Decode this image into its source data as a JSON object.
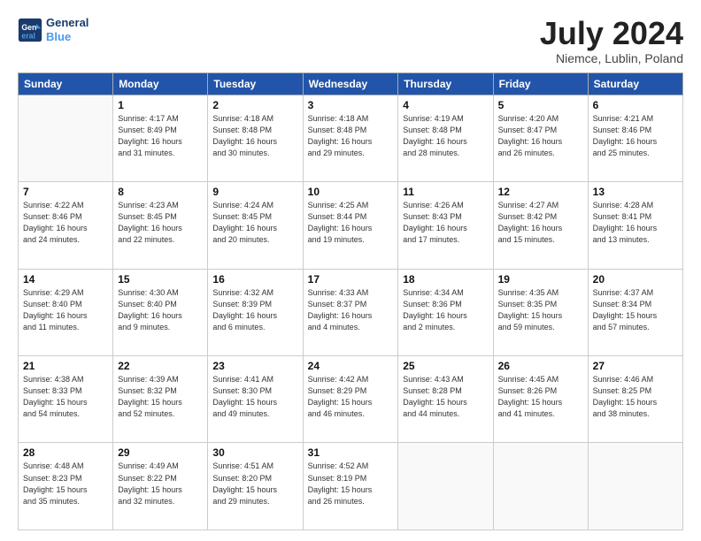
{
  "logo": {
    "line1": "General",
    "line2": "Blue"
  },
  "title": "July 2024",
  "subtitle": "Niemce, Lublin, Poland",
  "headers": [
    "Sunday",
    "Monday",
    "Tuesday",
    "Wednesday",
    "Thursday",
    "Friday",
    "Saturday"
  ],
  "weeks": [
    [
      {
        "day": "",
        "info": ""
      },
      {
        "day": "1",
        "info": "Sunrise: 4:17 AM\nSunset: 8:49 PM\nDaylight: 16 hours\nand 31 minutes."
      },
      {
        "day": "2",
        "info": "Sunrise: 4:18 AM\nSunset: 8:48 PM\nDaylight: 16 hours\nand 30 minutes."
      },
      {
        "day": "3",
        "info": "Sunrise: 4:18 AM\nSunset: 8:48 PM\nDaylight: 16 hours\nand 29 minutes."
      },
      {
        "day": "4",
        "info": "Sunrise: 4:19 AM\nSunset: 8:48 PM\nDaylight: 16 hours\nand 28 minutes."
      },
      {
        "day": "5",
        "info": "Sunrise: 4:20 AM\nSunset: 8:47 PM\nDaylight: 16 hours\nand 26 minutes."
      },
      {
        "day": "6",
        "info": "Sunrise: 4:21 AM\nSunset: 8:46 PM\nDaylight: 16 hours\nand 25 minutes."
      }
    ],
    [
      {
        "day": "7",
        "info": "Sunrise: 4:22 AM\nSunset: 8:46 PM\nDaylight: 16 hours\nand 24 minutes."
      },
      {
        "day": "8",
        "info": "Sunrise: 4:23 AM\nSunset: 8:45 PM\nDaylight: 16 hours\nand 22 minutes."
      },
      {
        "day": "9",
        "info": "Sunrise: 4:24 AM\nSunset: 8:45 PM\nDaylight: 16 hours\nand 20 minutes."
      },
      {
        "day": "10",
        "info": "Sunrise: 4:25 AM\nSunset: 8:44 PM\nDaylight: 16 hours\nand 19 minutes."
      },
      {
        "day": "11",
        "info": "Sunrise: 4:26 AM\nSunset: 8:43 PM\nDaylight: 16 hours\nand 17 minutes."
      },
      {
        "day": "12",
        "info": "Sunrise: 4:27 AM\nSunset: 8:42 PM\nDaylight: 16 hours\nand 15 minutes."
      },
      {
        "day": "13",
        "info": "Sunrise: 4:28 AM\nSunset: 8:41 PM\nDaylight: 16 hours\nand 13 minutes."
      }
    ],
    [
      {
        "day": "14",
        "info": "Sunrise: 4:29 AM\nSunset: 8:40 PM\nDaylight: 16 hours\nand 11 minutes."
      },
      {
        "day": "15",
        "info": "Sunrise: 4:30 AM\nSunset: 8:40 PM\nDaylight: 16 hours\nand 9 minutes."
      },
      {
        "day": "16",
        "info": "Sunrise: 4:32 AM\nSunset: 8:39 PM\nDaylight: 16 hours\nand 6 minutes."
      },
      {
        "day": "17",
        "info": "Sunrise: 4:33 AM\nSunset: 8:37 PM\nDaylight: 16 hours\nand 4 minutes."
      },
      {
        "day": "18",
        "info": "Sunrise: 4:34 AM\nSunset: 8:36 PM\nDaylight: 16 hours\nand 2 minutes."
      },
      {
        "day": "19",
        "info": "Sunrise: 4:35 AM\nSunset: 8:35 PM\nDaylight: 15 hours\nand 59 minutes."
      },
      {
        "day": "20",
        "info": "Sunrise: 4:37 AM\nSunset: 8:34 PM\nDaylight: 15 hours\nand 57 minutes."
      }
    ],
    [
      {
        "day": "21",
        "info": "Sunrise: 4:38 AM\nSunset: 8:33 PM\nDaylight: 15 hours\nand 54 minutes."
      },
      {
        "day": "22",
        "info": "Sunrise: 4:39 AM\nSunset: 8:32 PM\nDaylight: 15 hours\nand 52 minutes."
      },
      {
        "day": "23",
        "info": "Sunrise: 4:41 AM\nSunset: 8:30 PM\nDaylight: 15 hours\nand 49 minutes."
      },
      {
        "day": "24",
        "info": "Sunrise: 4:42 AM\nSunset: 8:29 PM\nDaylight: 15 hours\nand 46 minutes."
      },
      {
        "day": "25",
        "info": "Sunrise: 4:43 AM\nSunset: 8:28 PM\nDaylight: 15 hours\nand 44 minutes."
      },
      {
        "day": "26",
        "info": "Sunrise: 4:45 AM\nSunset: 8:26 PM\nDaylight: 15 hours\nand 41 minutes."
      },
      {
        "day": "27",
        "info": "Sunrise: 4:46 AM\nSunset: 8:25 PM\nDaylight: 15 hours\nand 38 minutes."
      }
    ],
    [
      {
        "day": "28",
        "info": "Sunrise: 4:48 AM\nSunset: 8:23 PM\nDaylight: 15 hours\nand 35 minutes."
      },
      {
        "day": "29",
        "info": "Sunrise: 4:49 AM\nSunset: 8:22 PM\nDaylight: 15 hours\nand 32 minutes."
      },
      {
        "day": "30",
        "info": "Sunrise: 4:51 AM\nSunset: 8:20 PM\nDaylight: 15 hours\nand 29 minutes."
      },
      {
        "day": "31",
        "info": "Sunrise: 4:52 AM\nSunset: 8:19 PM\nDaylight: 15 hours\nand 26 minutes."
      },
      {
        "day": "",
        "info": ""
      },
      {
        "day": "",
        "info": ""
      },
      {
        "day": "",
        "info": ""
      }
    ]
  ]
}
